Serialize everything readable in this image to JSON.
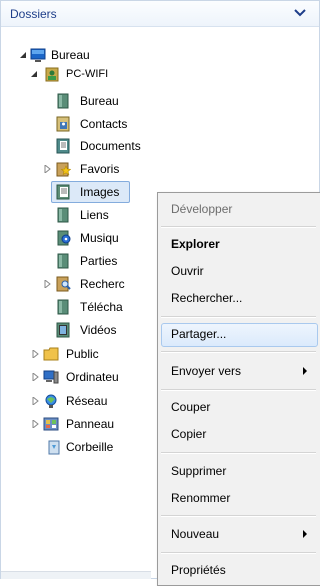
{
  "panel": {
    "title": "Dossiers"
  },
  "tree": {
    "bureau": "Bureau",
    "pc": "PC-WIFI",
    "items": [
      "Bureau",
      "Contacts",
      "Documents",
      "Favoris",
      "Images",
      "Liens",
      "Musiqu",
      "Parties",
      "Recherc",
      "Télécha",
      "Vidéos"
    ],
    "public": "Public",
    "ordinateur": "Ordinateu",
    "reseau": "Réseau",
    "panneau": "Panneau",
    "corbeille": "Corbeille"
  },
  "context_menu": {
    "developper": "Développer",
    "explorer": "Explorer",
    "ouvrir": "Ouvrir",
    "rechercher": "Rechercher...",
    "partager": "Partager...",
    "envoyer_vers": "Envoyer vers",
    "couper": "Couper",
    "copier": "Copier",
    "supprimer": "Supprimer",
    "renommer": "Renommer",
    "nouveau": "Nouveau",
    "proprietes": "Propriétés"
  }
}
